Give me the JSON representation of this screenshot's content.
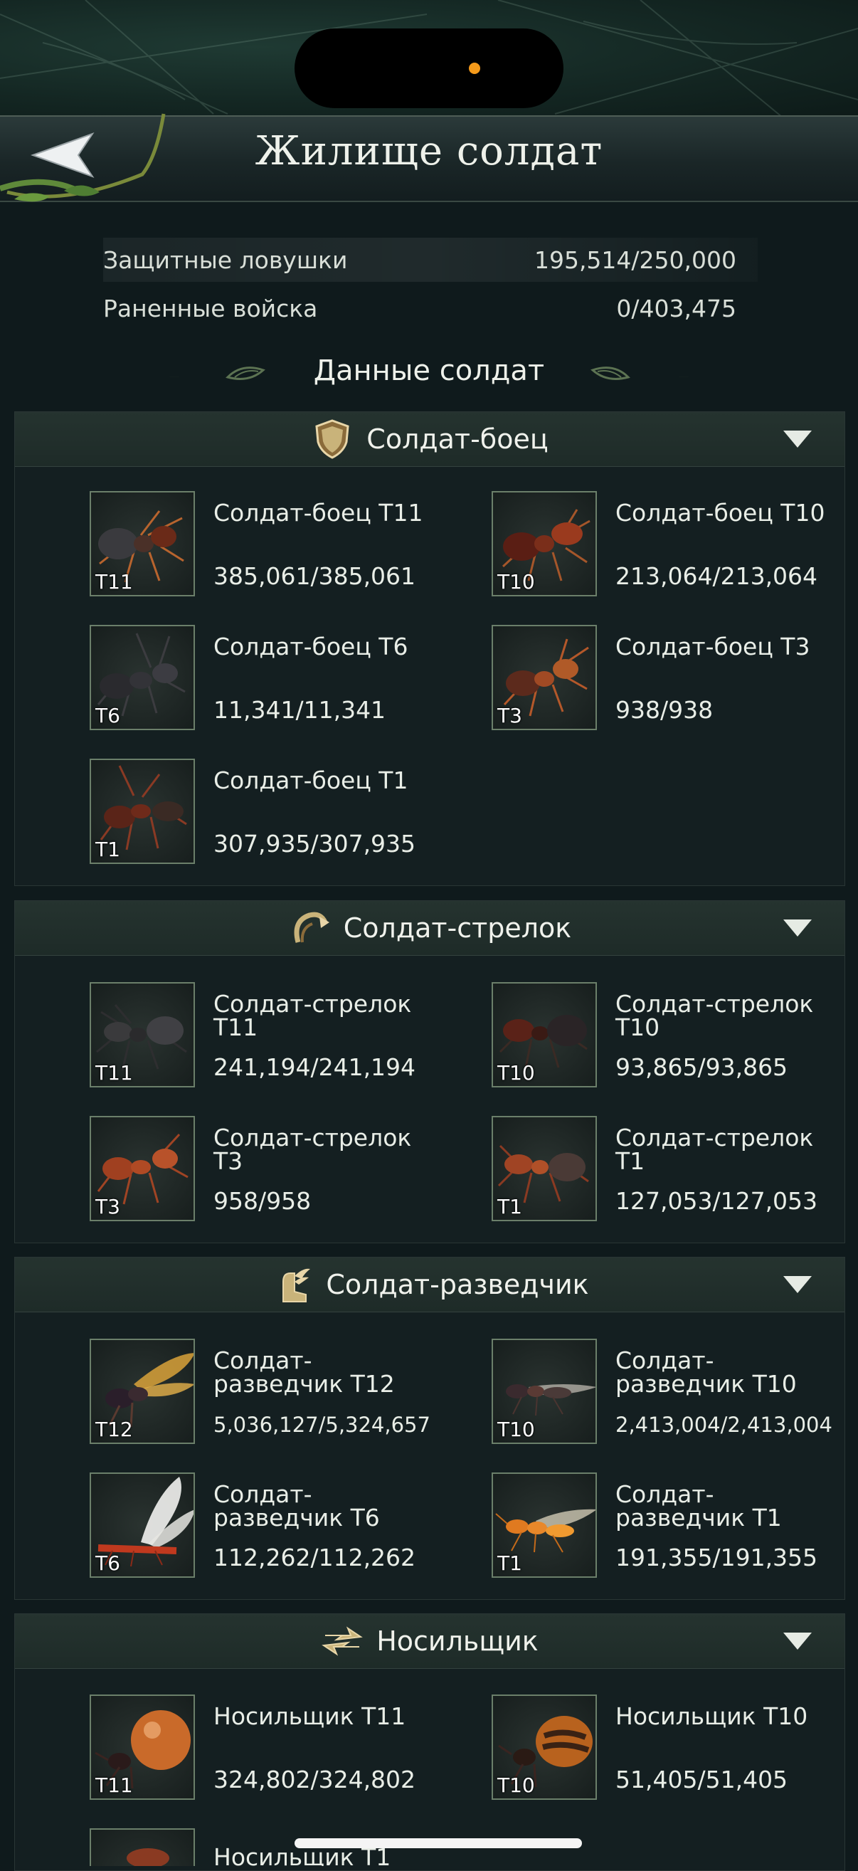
{
  "header": {
    "title": "Жилище солдат"
  },
  "stats": [
    {
      "label": "Защитные ловушки",
      "value": "195,514/250,000"
    },
    {
      "label": "Раненные войска",
      "value": "0/403,475"
    }
  ],
  "section_title": "Данные солдат",
  "categories": [
    {
      "label": "Солдат-боец",
      "icon": "shield-icon",
      "units": [
        {
          "name": "Солдат-боец T11",
          "tier": "T11",
          "count": "385,061/385,061"
        },
        {
          "name": "Солдат-боец T10",
          "tier": "T10",
          "count": "213,064/213,064"
        },
        {
          "name": "Солдат-боец T6",
          "tier": "T6",
          "count": "11,341/11,341"
        },
        {
          "name": "Солдат-боец T3",
          "tier": "T3",
          "count": "938/938"
        },
        {
          "name": "Солдат-боец T1",
          "tier": "T1",
          "count": "307,935/307,935"
        }
      ]
    },
    {
      "label": "Солдат-стрелок",
      "icon": "bow-icon",
      "units": [
        {
          "name": "Солдат-стрелок T11",
          "tier": "T11",
          "count": "241,194/241,194"
        },
        {
          "name": "Солдат-стрелок T10",
          "tier": "T10",
          "count": "93,865/93,865"
        },
        {
          "name": "Солдат-стрелок T3",
          "tier": "T3",
          "count": "958/958"
        },
        {
          "name": "Солдат-стрелок T1",
          "tier": "T1",
          "count": "127,053/127,053"
        }
      ]
    },
    {
      "label": "Солдат-разведчик",
      "icon": "winged-boot-icon",
      "units": [
        {
          "name": "Солдат-разведчик T12",
          "tier": "T12",
          "count": "5,036,127/5,324,657"
        },
        {
          "name": "Солдат-разведчик T10",
          "tier": "T10",
          "count": "2,413,004/2,413,004"
        },
        {
          "name": "Солдат-разведчик T6",
          "tier": "T6",
          "count": "112,262/112,262"
        },
        {
          "name": "Солдат-разведчик T1",
          "tier": "T1",
          "count": "191,355/191,355"
        }
      ]
    },
    {
      "label": "Носильщик",
      "icon": "transfer-arrows-icon",
      "units": [
        {
          "name": "Носильщик T11",
          "tier": "T11",
          "count": "324,802/324,802"
        },
        {
          "name": "Носильщик T10",
          "tier": "T10",
          "count": "51,405/51,405"
        },
        {
          "name": "Носильщик T1",
          "tier": "",
          "count": ""
        }
      ]
    }
  ],
  "colors": {
    "accent": "#c9b37a",
    "background": "#0f1a1c",
    "indicator": "#f59a1a"
  }
}
